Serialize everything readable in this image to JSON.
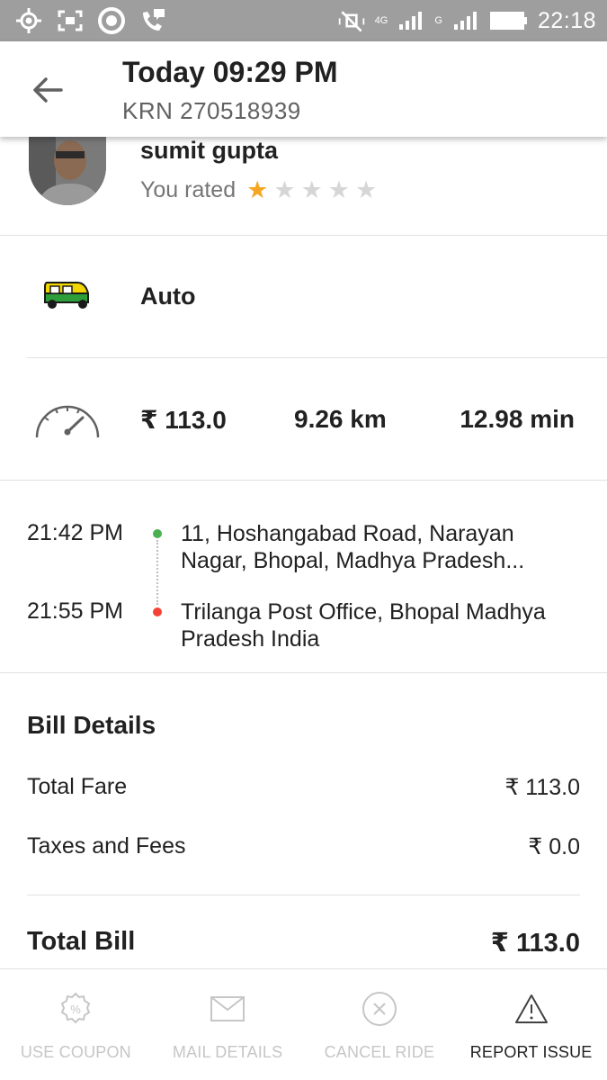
{
  "status_bar": {
    "network_4g_label": "4G",
    "network_g_label": "G",
    "time": "22:18"
  },
  "app_bar": {
    "title": "Today 09:29 PM",
    "subtitle": "KRN 270518939"
  },
  "driver": {
    "name": "sumit gupta",
    "rated_label": "You rated",
    "rating": 1,
    "max_rating": 5
  },
  "vehicle": {
    "type": "Auto"
  },
  "trip_stats": {
    "fare": "₹ 113.0",
    "distance": "9.26 km",
    "duration": "12.98 min"
  },
  "route": {
    "pickup": {
      "time": "21:42 PM",
      "address_line1": "11, Hoshangabad Road, Narayan",
      "address_line2": "Nagar, Bhopal, Madhya Pradesh..."
    },
    "drop": {
      "time": "21:55 PM",
      "address_line1": "Trilanga Post Office, Bhopal Madhya",
      "address_line2": "Pradesh India"
    }
  },
  "bill": {
    "title": "Bill Details",
    "rows": [
      {
        "label": "Total Fare",
        "amount": "₹ 113.0"
      },
      {
        "label": "Taxes and Fees",
        "amount": "₹ 0.0"
      }
    ],
    "total_label": "Total Bill",
    "total_amount": "₹ 113.0"
  },
  "actions": [
    {
      "label": "USE COUPON",
      "icon": "coupon-icon"
    },
    {
      "label": "MAIL DETAILS",
      "icon": "mail-icon"
    },
    {
      "label": "CANCEL RIDE",
      "icon": "cancel-circle-icon"
    },
    {
      "label": "REPORT ISSUE",
      "icon": "warning-icon"
    }
  ],
  "colors": {
    "status_bar_bg": "#9e9e9e",
    "star_active": "#f5a623",
    "star_inactive": "#d6d6d6",
    "pickup_dot": "#4caf50",
    "drop_dot": "#f44336",
    "disabled_action": "#c6c6c6"
  }
}
